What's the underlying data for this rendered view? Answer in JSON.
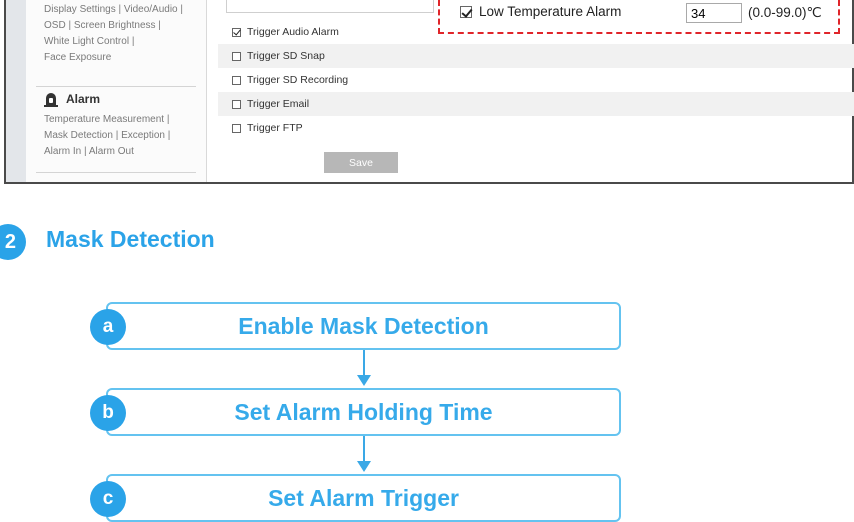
{
  "menu": {
    "display_links": [
      "Display Settings | Video/Audio |",
      "OSD | Screen Brightness |",
      "White Light Control |",
      "Face Exposure"
    ],
    "alarm_title": "Alarm",
    "alarm_links": [
      "Temperature Measurement |",
      "Mask Detection | Exception |",
      "Alarm In | Alarm Out"
    ]
  },
  "highlight": {
    "label": "Low Temperature Alarm",
    "value": "34",
    "range": "(0.0-99.0)℃",
    "checked": true
  },
  "triggers": [
    {
      "label": "Trigger Audio Alarm",
      "checked": true
    },
    {
      "label": "Trigger SD Snap",
      "checked": false
    },
    {
      "label": "Trigger SD Recording",
      "checked": false
    },
    {
      "label": "Trigger Email",
      "checked": false
    },
    {
      "label": "Trigger FTP",
      "checked": false
    }
  ],
  "save_label": "Save",
  "section": {
    "number": "2",
    "title": "Mask Detection"
  },
  "steps": [
    {
      "letter": "a",
      "text": "Enable Mask Detection"
    },
    {
      "letter": "b",
      "text": "Set Alarm Holding Time"
    },
    {
      "letter": "c",
      "text": "Set Alarm Trigger"
    }
  ],
  "colors": {
    "accent": "#2aa3e8",
    "highlight_border": "#e0252a",
    "box_border": "#64c3f0"
  }
}
